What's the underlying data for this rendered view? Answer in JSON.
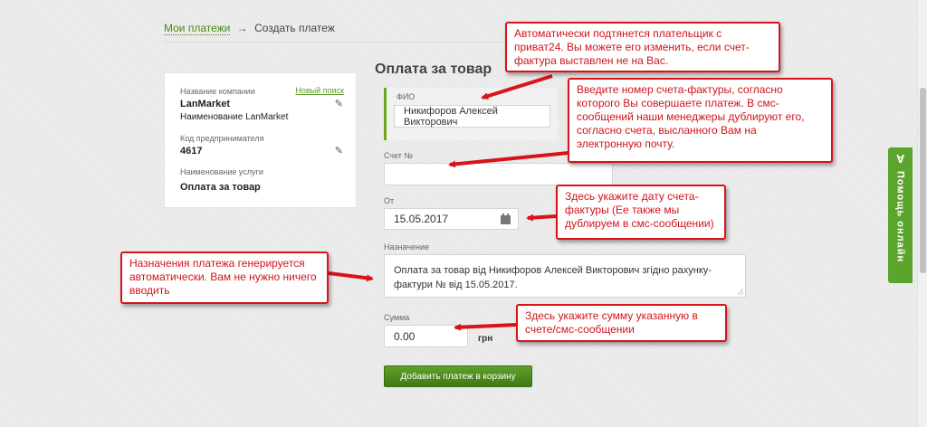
{
  "breadcrumb": {
    "link": "Мои платежи",
    "arrow": "→",
    "current": "Создать платеж"
  },
  "company": {
    "name_label": "Название компании",
    "new_search": "Новый поиск",
    "name": "LanMarket",
    "full_name": "Наименование LanMarket",
    "code_label": "Код предпринимателя",
    "code": "4617",
    "service_label": "Наименование услуги",
    "service": "Оплата за товар"
  },
  "form": {
    "title": "Оплата за товар",
    "fio_label": "ФИО",
    "fio_value": "Никифоров Алексей Викторович",
    "invoice_label": "Счет №",
    "invoice_value": "",
    "date_label": "От",
    "date_value": "15.05.2017",
    "purpose_label": "Назначение",
    "purpose_value": "Оплата за товар від Никифоров Алексей Викторович  згідно рахунку-фактури № від 15.05.2017.",
    "amount_label": "Сумма",
    "amount_value": "0.00",
    "currency": "грн",
    "submit": "Добавить платеж в корзину"
  },
  "callouts": {
    "payer": "Автоматически подтянется плательщик с приват24. Вы можете его изменить, если счет-фактура выставлен не на Вас.",
    "invoice": "Введите номер счета-фактуры, согласно которого Вы совершаете платеж. В смс-сообщений наши менеджеры дублируют его, согласно счета, высланного Вам на электронную почту.",
    "date": "Здесь укажите дату  счета-фактуры (Ее также мы дублируем в смс-сообщении)",
    "purpose": "Назначения платежа генерируется автоматически. Вам не нужно ничего вводить",
    "amount": "Здесь укажите сумму указанную в счете/смс-сообщении"
  },
  "help": {
    "label": "Помощь онлайн",
    "icon": "chat-icon"
  },
  "colors": {
    "accent": "#5ca52d",
    "callout": "#d9131a"
  }
}
